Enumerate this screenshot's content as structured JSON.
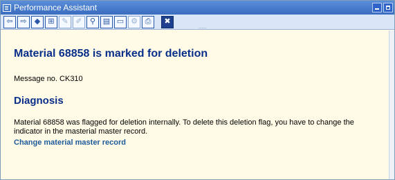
{
  "window": {
    "title": "Performance Assistant",
    "controls": [
      "minimize",
      "maximize"
    ]
  },
  "toolbar": {
    "buttons": [
      {
        "name": "back-arrow-icon",
        "glyph": "⇦"
      },
      {
        "name": "forward-arrow-icon",
        "glyph": "⇨"
      },
      {
        "name": "bookmark-icon",
        "glyph": "◆"
      },
      {
        "name": "structure-icon",
        "glyph": "⊞"
      },
      {
        "name": "edit-icon",
        "glyph": "✎"
      },
      {
        "name": "note-icon",
        "glyph": "✐"
      },
      {
        "name": "find-icon",
        "glyph": "⚲"
      },
      {
        "name": "document-icon",
        "glyph": "▤"
      },
      {
        "name": "display-icon",
        "glyph": "▭"
      },
      {
        "name": "technical-info-icon",
        "glyph": "⚙"
      },
      {
        "name": "print-icon",
        "glyph": "⎙"
      },
      {
        "name": "close-icon",
        "glyph": "✖"
      }
    ],
    "grip": "....."
  },
  "content": {
    "title": "Material 68858 is marked for deletion",
    "message_no": "Message no. CK310",
    "diagnosis_heading": "Diagnosis",
    "diagnosis_text": "Material 68858 was flagged for deletion internally.  To delete this deletion flag, you have to change the indicator in the masterial master record.",
    "link": "Change material master record"
  },
  "colors": {
    "background": "#fffbe6",
    "heading": "#0a2f8a",
    "link": "#1c5a9c",
    "titlebar": "#3a6cc0"
  }
}
